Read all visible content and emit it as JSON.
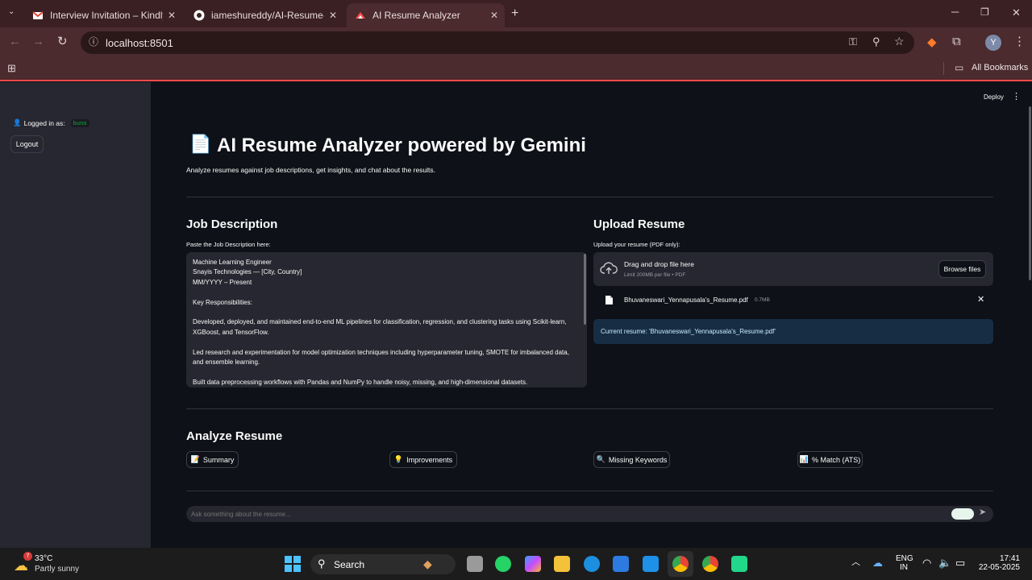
{
  "browser": {
    "tabs": [
      {
        "title": "Interview Invitation – Kindly Pro",
        "icon": "gmail-icon"
      },
      {
        "title": "iameshureddy/AI-Resume-Anal",
        "icon": "github-icon"
      },
      {
        "title": "AI Resume Analyzer",
        "icon": "streamlit-icon"
      }
    ],
    "url": "localhost:8501",
    "bookmarks_label": "All Bookmarks",
    "profile_initial": "Y"
  },
  "sidebar": {
    "logged_in_label": "Logged in as:",
    "username": "buno",
    "logout": "Logout"
  },
  "app": {
    "deploy": "Deploy",
    "title_emoji": "📄",
    "title": "AI Resume Analyzer powered by Gemini",
    "subtitle": "Analyze resumes against job descriptions, get insights, and chat about the results.",
    "jd_heading": "Job Description",
    "jd_label": "Paste the Job Description here:",
    "jd_text": "Machine Learning Engineer\nSnayis Technologies — [City, Country]\nMM/YYYY – Present\n\nKey Responsibilities:\n\nDeveloped, deployed, and maintained end-to-end ML pipelines for classification, regression, and clustering tasks using Scikit-learn, XGBoost, and TensorFlow.\n\nLed research and experimentation for model optimization techniques including hyperparameter tuning, SMOTE for imbalanced data, and ensemble learning.\n\nBuilt data preprocessing workflows with Pandas and NumPy to handle noisy, missing, and high-dimensional datasets.",
    "upload_heading": "Upload Resume",
    "upload_label": "Upload your resume (PDF only):",
    "drop_title": "Drag and drop file here",
    "drop_limit": "Limit 200MB per file • PDF",
    "browse": "Browse files",
    "file_name": "Bhuvaneswari_Yennapusala's_Resume.pdf",
    "file_size": "0.7MB",
    "current_resume": "Current resume: 'Bhuvaneswari_Yennapusala's_Resume.pdf'",
    "analyze_heading": "Analyze Resume",
    "actions": [
      {
        "emoji": "📝",
        "label": "Summary"
      },
      {
        "emoji": "💡",
        "label": "Improvements"
      },
      {
        "emoji": "🔍",
        "label": "Missing Keywords"
      },
      {
        "emoji": "📊",
        "label": "% Match (ATS)"
      }
    ],
    "chat_placeholder": "Ask something about the resume..."
  },
  "taskbar": {
    "weather_temp": "33°C",
    "weather_desc": "Partly sunny",
    "weather_badge": "7",
    "search": "Search",
    "lang": "ENG",
    "region": "IN",
    "time": "17:41",
    "date": "22-05-2025"
  },
  "colors": {
    "accent": "#ff4b4b",
    "info_bg": "#172d43",
    "info_text": "#c7ebff"
  }
}
